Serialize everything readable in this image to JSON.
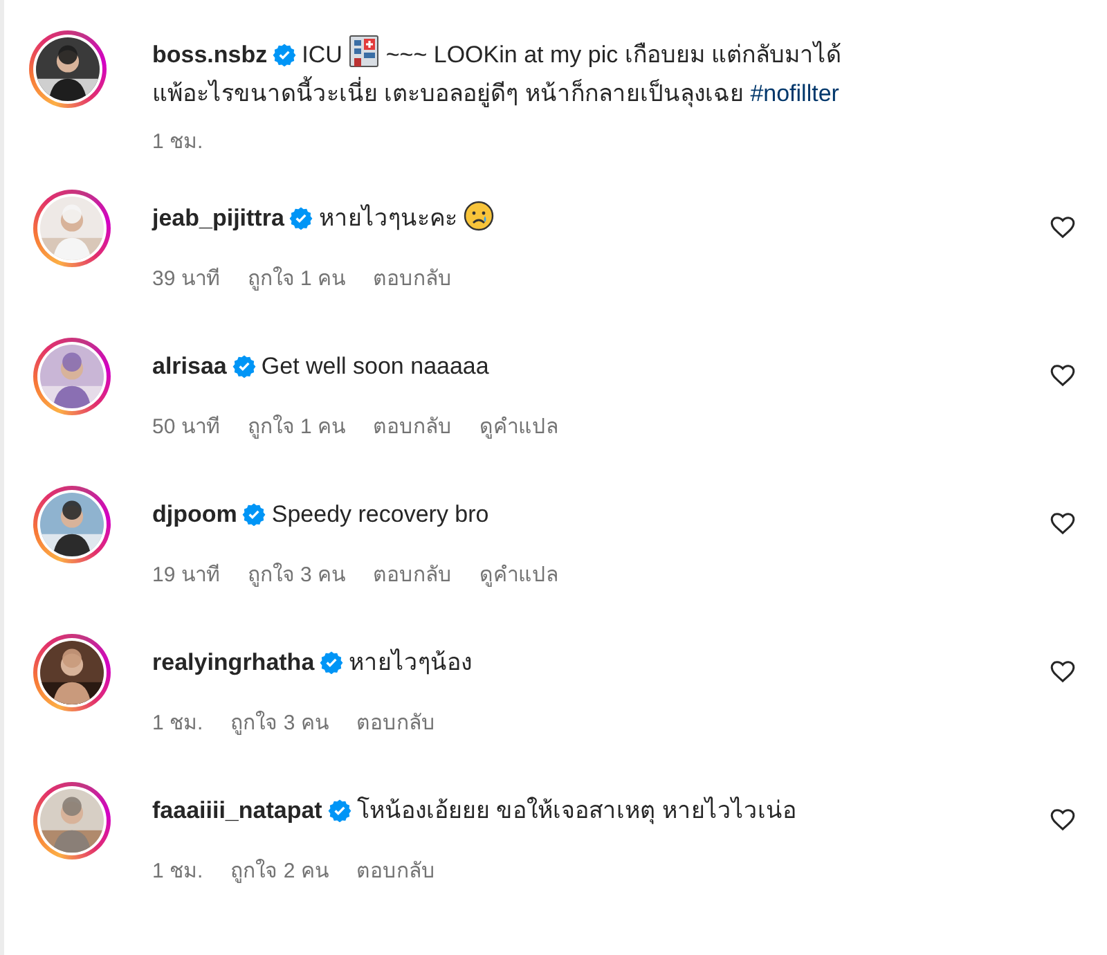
{
  "post": {
    "username": "boss.nsbz",
    "verified": true,
    "caption_lines": [
      [
        {
          "kind": "text",
          "text": "ICU"
        },
        {
          "kind": "hospital"
        },
        {
          "kind": "text",
          "text": "~~~ LOOKin at my pic เกือบยม แต่กลับมาได้"
        }
      ],
      [
        {
          "kind": "text",
          "text": "แพ้อะไรขนาดนี้วะเนี่ย เตะบอลอยู่ดีๆ หน้าก็กลายเป็นลุงเฉย"
        },
        {
          "kind": "hashtag",
          "text": "#nofillter"
        }
      ]
    ],
    "time": "1 ชม."
  },
  "comments": [
    {
      "username": "jeab_pijittra",
      "verified": true,
      "kind": "emoji",
      "text": "หายไวๆนะคะ",
      "time": "39 นาที",
      "likes": "ถูกใจ 1 คน",
      "reply": "ตอบกลับ"
    },
    {
      "username": "alrisaa",
      "verified": true,
      "kind": "plain",
      "text": "Get well soon naaaaa",
      "time": "50 นาที",
      "likes": "ถูกใจ 1 คน",
      "reply": "ตอบกลับ",
      "translate": "ดูคำแปล"
    },
    {
      "username": "djpoom",
      "verified": true,
      "kind": "plain",
      "text": "Speedy recovery bro",
      "time": "19 นาที",
      "likes": "ถูกใจ 3 คน",
      "reply": "ตอบกลับ",
      "translate": "ดูคำแปล"
    },
    {
      "username": "realyingrhatha",
      "verified": true,
      "kind": "plain",
      "text": "หายไวๆน้อง",
      "time": "1 ชม.",
      "likes": "ถูกใจ 3 คน",
      "reply": "ตอบกลับ"
    },
    {
      "username": "faaaiiii_natapat",
      "verified": true,
      "kind": "plain",
      "text": "โหน้องเอ้ยยย ขอให้เจอสาเหตุ หายไวไวเน่อ",
      "time": "1 ชม.",
      "likes": "ถูกใจ 2 คน",
      "reply": "ตอบกลับ"
    }
  ]
}
